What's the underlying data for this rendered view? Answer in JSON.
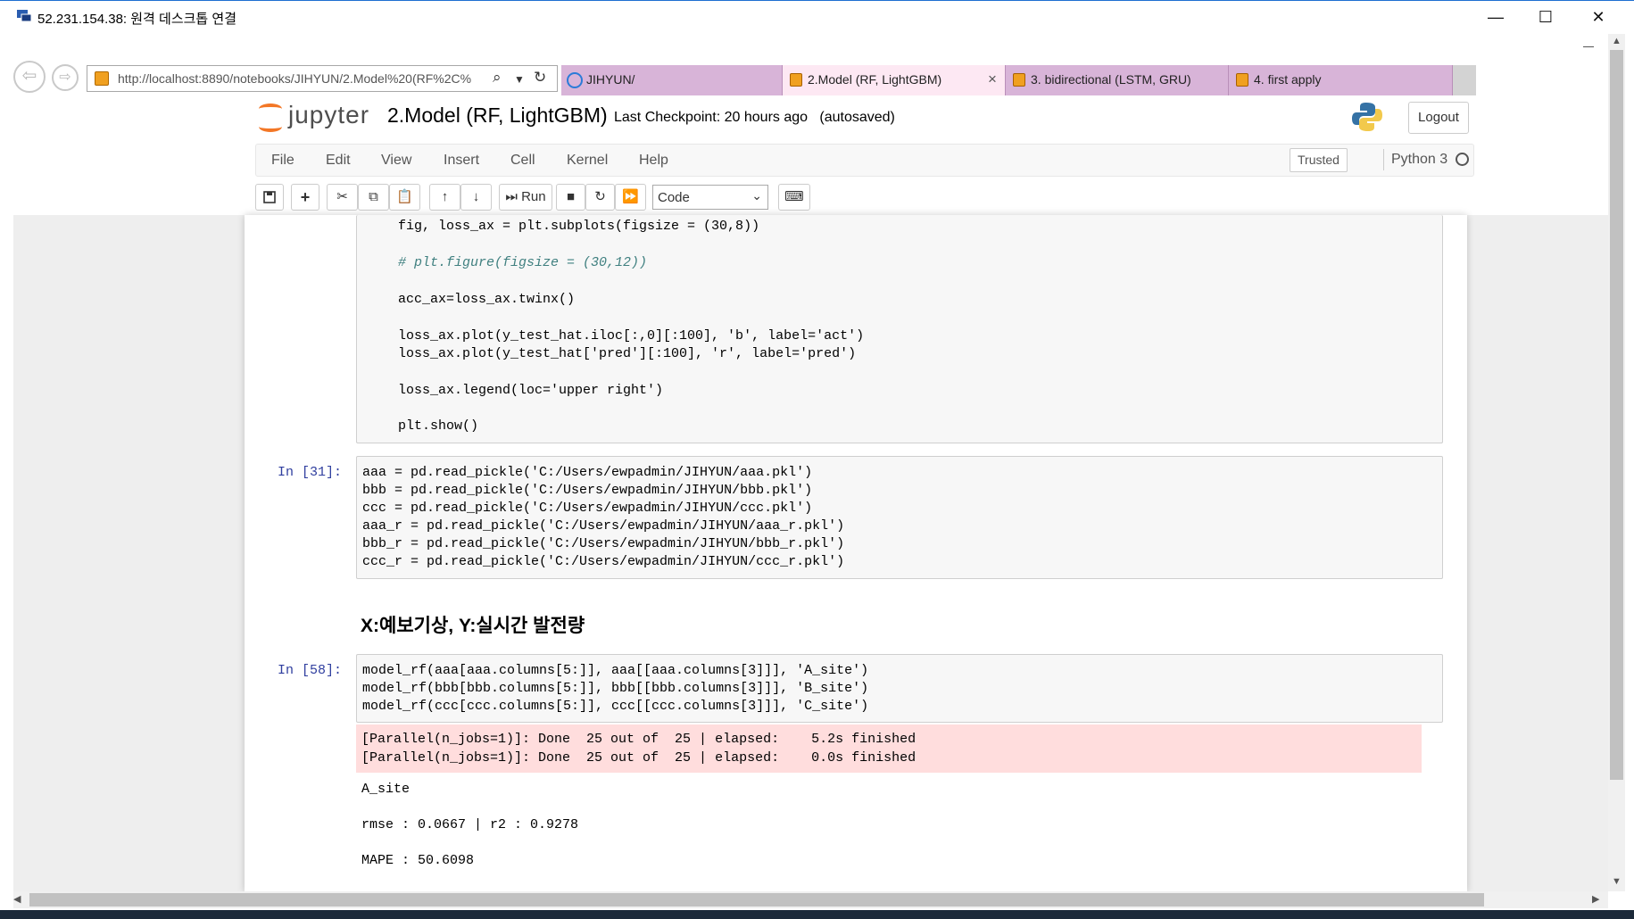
{
  "rdp": {
    "title": "52.231.154.38: 원격 데스크톱 연결",
    "min": "—",
    "max": "☐",
    "close": "✕"
  },
  "browser": {
    "back": "⇦",
    "forward": "⇨",
    "url": "http://localhost:8890/notebooks/JIHYUN/2.Model%20(RF%2C%",
    "tabs": [
      {
        "label": "JIHYUN/"
      },
      {
        "label": "2.Model (RF, LightGBM)",
        "close": "×"
      },
      {
        "label": "3. bidirectional (LSTM, GRU)"
      },
      {
        "label": "4. first apply"
      }
    ]
  },
  "jupyter": {
    "logo_text": "jupyter",
    "notebook_name": "2.Model (RF, LightGBM)",
    "checkpoint": "Last Checkpoint: 20 hours ago",
    "autosave": "(autosaved)",
    "logout": "Logout",
    "menu": [
      "File",
      "Edit",
      "View",
      "Insert",
      "Cell",
      "Kernel",
      "Help"
    ],
    "trusted": "Trusted",
    "kernel": "Python 3",
    "toolbar": {
      "run": "Run",
      "cell_type": "Code"
    }
  },
  "cells": {
    "c1_lines": [
      "fig, loss_ax = plt.subplots(figsize = (30,8))",
      "# plt.figure(figsize = (30,12))",
      "acc_ax=loss_ax.twinx()",
      "loss_ax.plot(y_test_hat.iloc[:,0][:100], 'b', label='act')",
      "loss_ax.plot(y_test_hat['pred'][:100], 'r', label='pred')",
      "loss_ax.legend(loc='upper right')",
      "plt.show()"
    ],
    "c2_prompt": "In [31]:",
    "c2_lines": [
      "aaa = pd.read_pickle('C:/Users/ewpadmin/JIHYUN/aaa.pkl')",
      "bbb = pd.read_pickle('C:/Users/ewpadmin/JIHYUN/bbb.pkl')",
      "ccc = pd.read_pickle('C:/Users/ewpadmin/JIHYUN/ccc.pkl')",
      "aaa_r = pd.read_pickle('C:/Users/ewpadmin/JIHYUN/aaa_r.pkl')",
      "bbb_r = pd.read_pickle('C:/Users/ewpadmin/JIHYUN/bbb_r.pkl')",
      "ccc_r = pd.read_pickle('C:/Users/ewpadmin/JIHYUN/ccc_r.pkl')"
    ],
    "heading": "X:예보기상, Y:실시간 발전량",
    "c3_prompt": "In [58]:",
    "c3_lines": [
      "model_rf(aaa[aaa.columns[5:]], aaa[[aaa.columns[3]]], 'A_site')",
      "model_rf(bbb[bbb.columns[5:]], bbb[[bbb.columns[3]]], 'B_site')",
      "model_rf(ccc[ccc.columns[5:]], ccc[[ccc.columns[3]]], 'C_site')"
    ],
    "stderr_lines": [
      "[Parallel(n_jobs=1)]: Done  25 out of  25 | elapsed:    5.2s finished",
      "[Parallel(n_jobs=1)]: Done  25 out of  25 | elapsed:    0.0s finished"
    ],
    "out_site": "A_site",
    "out_metrics": "rmse : 0.0667 | r2 : 0.9278",
    "out_mape": "MAPE : 50.6098"
  }
}
